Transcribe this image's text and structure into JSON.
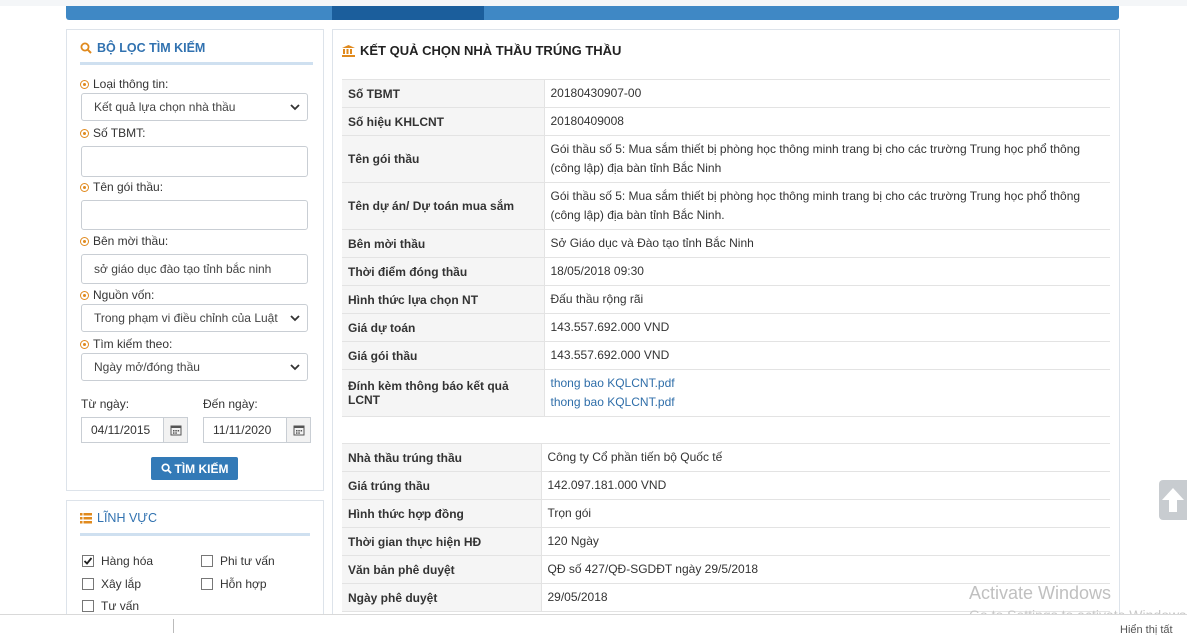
{
  "filter": {
    "title": "BỘ LỌC TÌM KIẾM",
    "loai_label": "Loại thông tin:",
    "loai_value": "Kết quả lựa chọn nhà thầu",
    "sotbmt_label": "Số TBMT:",
    "sotbmt_value": "",
    "tengoi_label": "Tên gói thầu:",
    "tengoi_value": "",
    "benmoi_label": "Bên mời thầu:",
    "benmoi_value": "sở giáo dục đào tạo tỉnh bắc ninh",
    "nguonvon_label": "Nguồn vốn:",
    "nguonvon_value": "Trong phạm vi điều chỉnh của Luật đ",
    "timtheo_label": "Tìm kiếm theo:",
    "timtheo_value": "Ngày mở/đóng thầu",
    "tungay_label": "Từ ngày:",
    "tungay_value": "04/11/2015",
    "denngay_label": "Đến ngày:",
    "denngay_value": "11/11/2020",
    "search_button": "TÌM KIẾM"
  },
  "linhvuc": {
    "title": "LĨNH VỰC",
    "hanghoa": "Hàng hóa",
    "phituvan": "Phi tư vấn",
    "xaylap": "Xây lắp",
    "honhop": "Hỗn hợp",
    "tuvan": "Tư vấn",
    "checked": [
      "Hàng hóa"
    ]
  },
  "result": {
    "title": "KẾT QUẢ CHỌN NHÀ THẦU TRÚNG THẦU",
    "rows": [
      {
        "k": "Số TBMT",
        "v": "20180430907-00"
      },
      {
        "k": "Số hiệu KHLCNT",
        "v": "20180409008"
      },
      {
        "k": "Tên gói thầu",
        "v": "Gói thầu số 5: Mua sắm thiết bị phòng học thông minh trang bị cho các trường Trung học phổ thông (công lập) địa bàn tỉnh Bắc Ninh"
      },
      {
        "k": "Tên dự án/ Dự toán mua sắm",
        "v": "Gói thầu số 5: Mua sắm thiết bị phòng học thông minh trang bị cho các trường Trung học phổ thông (công lập) địa bàn tỉnh Bắc Ninh."
      },
      {
        "k": "Bên mời thầu",
        "v": "Sở Giáo dục và Đào tạo tỉnh Bắc Ninh"
      },
      {
        "k": "Thời điểm đóng thầu",
        "v": "18/05/2018 09:30"
      },
      {
        "k": "Hình thức lựa chọn NT",
        "v": "Đấu thầu rộng rãi"
      },
      {
        "k": "Giá dự toán",
        "v": "143.557.692.000 VND"
      },
      {
        "k": "Giá gói thầu",
        "v": "143.557.692.000 VND"
      },
      {
        "k": "Đính kèm thông báo kết quả LCNT",
        "links": [
          "thong bao KQLCNT.pdf",
          "thong bao KQLCNT.pdf"
        ]
      }
    ],
    "rows2": [
      {
        "k": "Nhà thầu trúng thầu",
        "v": "Công ty Cổ phần tiến bộ Quốc tế"
      },
      {
        "k": "Giá trúng thầu",
        "v": "142.097.181.000 VND"
      },
      {
        "k": "Hình thức hợp đồng",
        "v": "Trọn gói"
      },
      {
        "k": "Thời gian thực hiện HĐ",
        "v": "120 Ngày"
      },
      {
        "k": "Văn bản phê duyệt",
        "v": "QĐ số 427/QĐ-SGDĐT ngày 29/5/2018"
      },
      {
        "k": "Ngày phê duyệt",
        "v": "29/05/2018"
      }
    ]
  },
  "watermark": {
    "line1": "Activate Windows",
    "line2": "Go to Settings to activate Windows."
  },
  "taskbar_hint": "Hiển thị tất"
}
